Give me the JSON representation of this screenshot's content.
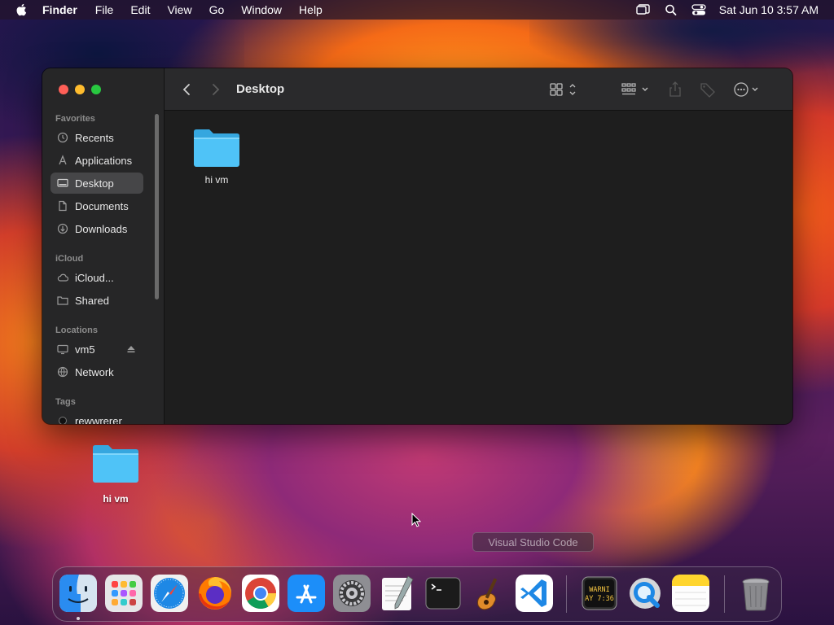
{
  "menubar": {
    "app_name": "Finder",
    "menus": [
      "File",
      "Edit",
      "View",
      "Go",
      "Window",
      "Help"
    ],
    "clock": "Sat Jun 10  3:57 AM"
  },
  "finder": {
    "title": "Desktop",
    "sidebar": {
      "sections": {
        "favorites": "Favorites",
        "icloud": "iCloud",
        "locations": "Locations",
        "tags": "Tags"
      },
      "favorites": [
        {
          "label": "Recents",
          "icon": "clock-icon"
        },
        {
          "label": "Applications",
          "icon": "applications-icon"
        },
        {
          "label": "Desktop",
          "icon": "desktop-icon",
          "selected": true
        },
        {
          "label": "Documents",
          "icon": "document-icon"
        },
        {
          "label": "Downloads",
          "icon": "download-icon"
        }
      ],
      "icloud": [
        {
          "label": "iCloud...",
          "icon": "cloud-icon"
        },
        {
          "label": "Shared",
          "icon": "shared-folder-icon"
        }
      ],
      "locations": [
        {
          "label": "vm5",
          "icon": "display-icon"
        },
        {
          "label": "Network",
          "icon": "network-icon"
        }
      ],
      "tags": [
        {
          "label": "rewwrerer",
          "icon": "tag-dot-icon"
        }
      ]
    },
    "files": [
      {
        "name": "hi vm",
        "icon": "folder-icon"
      }
    ]
  },
  "desktop": {
    "icons": [
      {
        "name": "hi vm",
        "icon": "folder-icon"
      }
    ]
  },
  "tooltip": "Visual Studio Code",
  "dock": {
    "apps": [
      "Finder",
      "Launchpad",
      "Safari",
      "Firefox",
      "Google Chrome",
      "App Store",
      "System Settings",
      "TextEdit",
      "Terminal",
      "GarageBand",
      "Visual Studio Code",
      "Console",
      "QuickTime Player",
      "Notes",
      "Trash"
    ],
    "console_text": "WARNI\nAY 7:36"
  },
  "colors": {
    "folder": "#4fc3f7",
    "selected": "#464648",
    "window_bg": "#1e1e1e"
  }
}
